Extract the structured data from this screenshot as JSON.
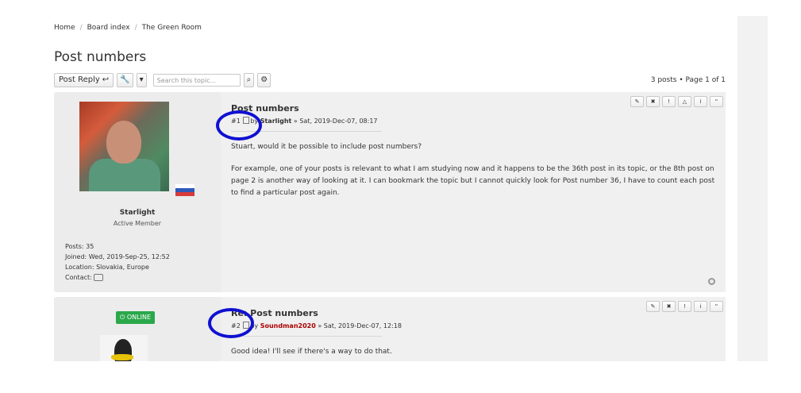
{
  "breadcrumb": {
    "home": "Home",
    "board": "Board index",
    "forum": "The Green Room"
  },
  "page_title": "Post numbers",
  "toolbar": {
    "post_reply": "Post Reply",
    "search_placeholder": "Search this topic...",
    "pagination": "3 posts • Page 1 of 1"
  },
  "posts": [
    {
      "title": "Post numbers",
      "number": "#1",
      "by": "by",
      "author": "Starlight",
      "date": "» Sat, 2019-Dec-07, 08:17",
      "flag": "Slovakia",
      "rank": "Active Member",
      "stats": [
        "Posts: 35",
        "Joined: Wed, 2019-Sep-25, 12:52",
        "Location: Slovakia, Europe",
        "Contact:"
      ],
      "content": [
        "Stuart, would it be possible to include post numbers?",
        "For example, one of your posts is relevant to what I am studying now and it happens to be the 36th post in its topic, or the 8th post on page 2 is another way of looking at it. I can bookmark the topic but I cannot quickly look for Post number 36, I have to count each post to find a particular post again."
      ]
    },
    {
      "title": "Re: Post numbers",
      "number": "#2",
      "by": "by",
      "author": "Soundman2020",
      "date": "» Sat, 2019-Dec-07, 12:18",
      "online_label": "ONLINE",
      "content": [
        "Good idea! I'll see if there's a way to do that."
      ]
    }
  ],
  "colors": {
    "annotation_circle": "#1010d2",
    "online_badge": "#2aa84a",
    "author_red": "#aa0000"
  }
}
